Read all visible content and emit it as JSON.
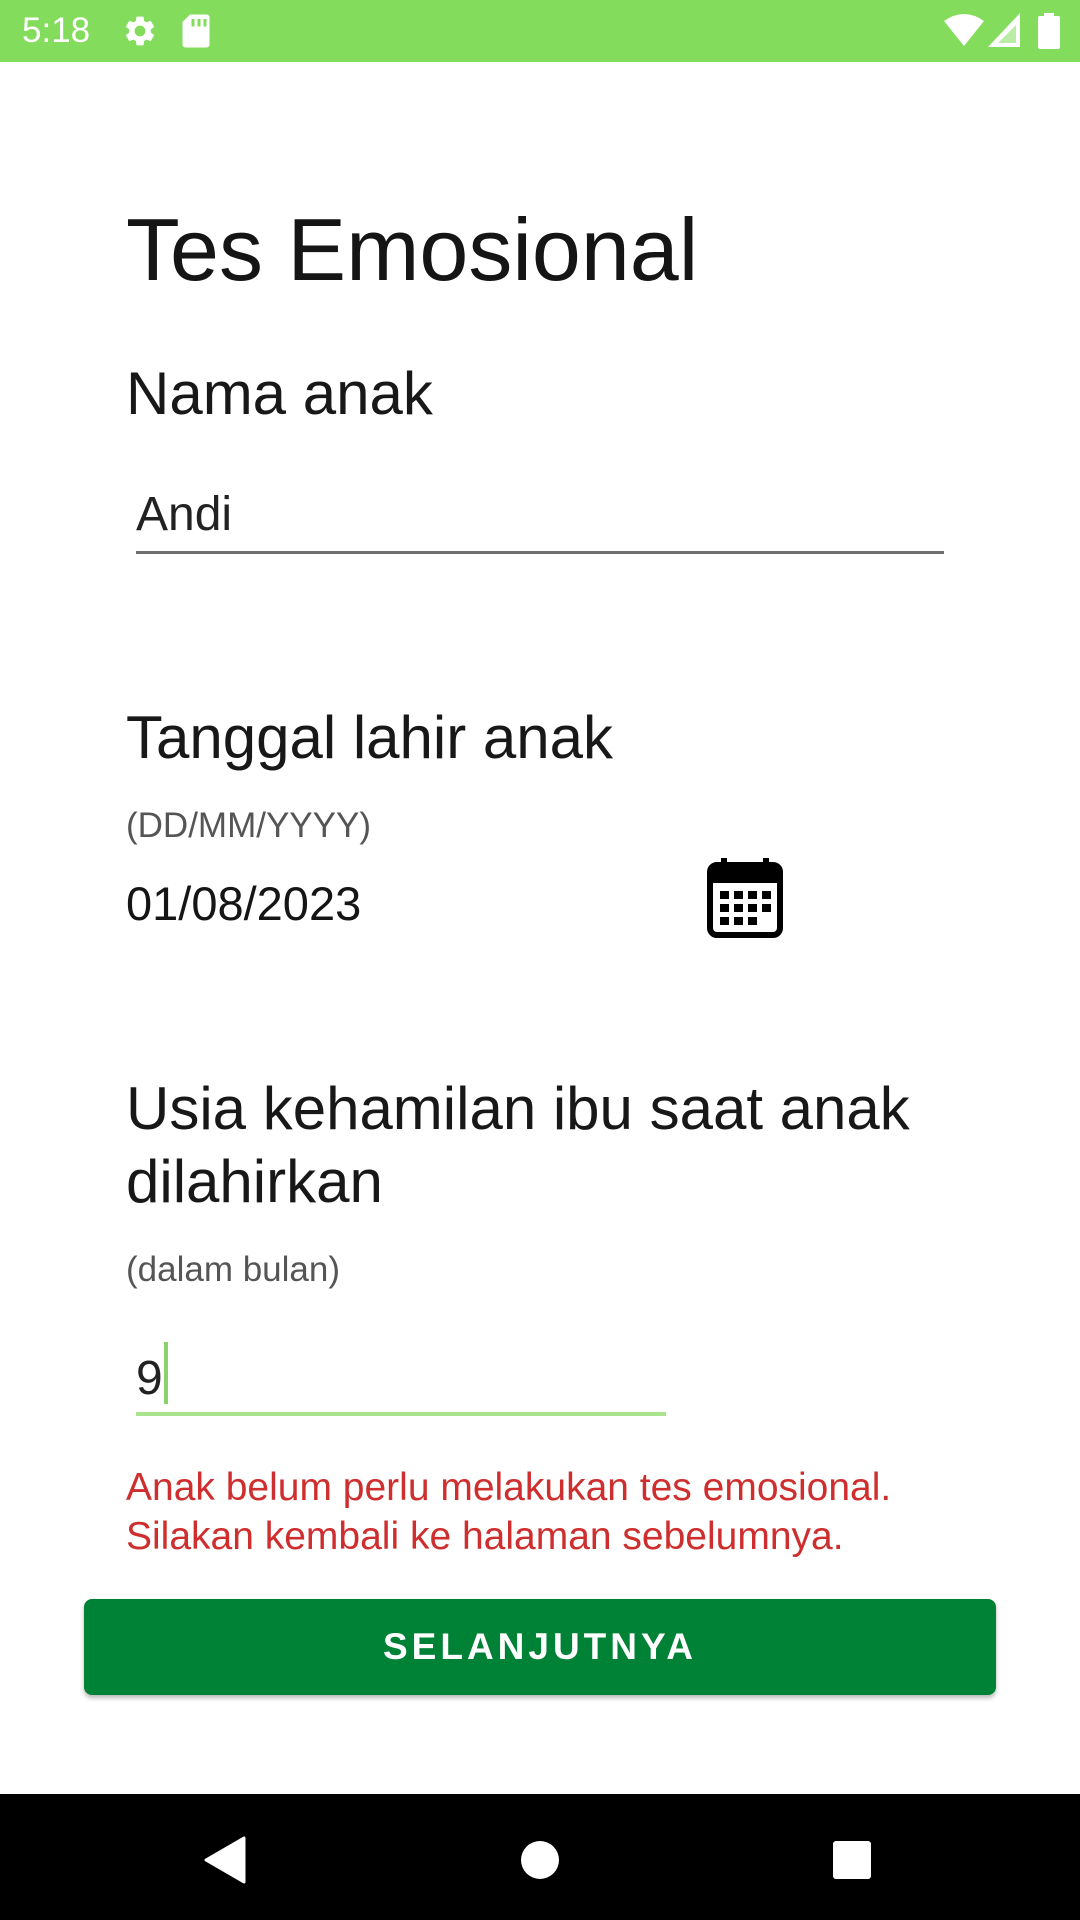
{
  "status_bar": {
    "time": "5:18",
    "icons": [
      "settings-icon",
      "sd-card-icon",
      "wifi-icon",
      "signal-icon",
      "battery-icon"
    ],
    "background_color": "#83dc5c"
  },
  "page": {
    "title": "Tes Emosional"
  },
  "child_name": {
    "label": "Nama anak",
    "value": "Andi"
  },
  "birth_date": {
    "label": "Tanggal lahir anak",
    "format_hint": "(DD/MM/YYYY)",
    "value": "01/08/2023",
    "icon": "calendar-icon"
  },
  "gestational_age": {
    "label": "Usia kehamilan ibu saat anak dilahirkan",
    "unit_hint": "(dalam bulan)",
    "value": "9",
    "focus_color": "#a9e38e"
  },
  "error": {
    "line1": "Anak belum perlu melakukan tes emosional.",
    "line2": "Silakan kembali ke halaman sebelumnya.",
    "color": "#cf2e2e"
  },
  "next_button": {
    "label": "SELANJUTNYA",
    "color": "#008236"
  },
  "nav_bar": {
    "icons": [
      "back-icon",
      "home-icon",
      "recents-icon"
    ]
  }
}
